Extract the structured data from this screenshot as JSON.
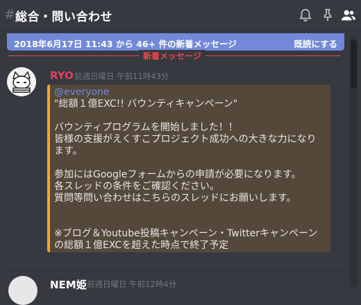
{
  "header": {
    "hash": "#",
    "channel_name": "総合・問い合わせ",
    "icons": [
      "bell-icon",
      "pin-icon",
      "members-icon"
    ]
  },
  "new_messages_bar": {
    "text": "2018年6月17日 11:43 から 46+ 件の新着メッセージ",
    "mark_read": "既読にする",
    "color": "#7289da"
  },
  "divider": {
    "label": "新着メッセージ",
    "color": "#f04747"
  },
  "messages": [
    {
      "author": "RYO",
      "author_color": "#e0405f",
      "timestamp": "前週日曜日 午前11時43分",
      "embed": {
        "mention": "@everyone",
        "text": "\"総額１億EXC!! バウンティキャンペーン\"\n\nバウンティプログラムを開始しました！！\n皆様の支援がえくすこプロジェクト成功への大きな力になります。\n\n参加にはGoogleフォームからの申請が必要になります。\n各スレッドの条件をご確認ください。\n質問等問い合わせはこちらのスレッドにお願いします。\n\n\n※ブログ＆Youtube投稿キャンペーン・Twitterキャンペーンの総額１億EXCを超えた時点で終了予定",
        "border_color": "#f6a623"
      }
    },
    {
      "author": "NEM姫",
      "timestamp": "前週日曜日 午前12時4分"
    }
  ]
}
